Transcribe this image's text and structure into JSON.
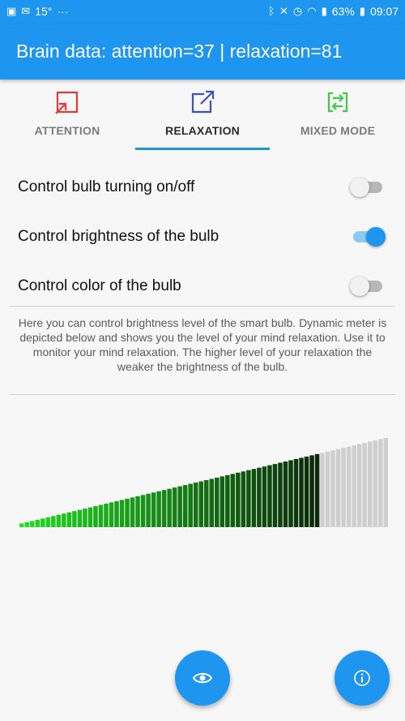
{
  "status_bar": {
    "temperature": "15°",
    "dots": "···",
    "battery": "63%",
    "time": "09:07"
  },
  "appbar": {
    "title": "Brain data: attention=37 | relaxation=81"
  },
  "tabs": [
    {
      "label": "ATTENTION",
      "icon": "enter-box-icon",
      "color": "#e53935",
      "active": false
    },
    {
      "label": "RELAXATION",
      "icon": "exit-box-icon",
      "color": "#3f51b5",
      "active": true
    },
    {
      "label": "MIXED MODE",
      "icon": "swap-box-icon",
      "color": "#43c84a",
      "active": false
    }
  ],
  "settings": [
    {
      "label": "Control bulb turning on/off",
      "on": false
    },
    {
      "label": "Control brightness of the bulb",
      "on": true
    },
    {
      "label": "Control color of the bulb",
      "on": false
    }
  ],
  "description": "Here you can control brightness level of the smart bulb. Dynamic meter is depicted below and shows you the level of your mind relaxation. Use it to monitor your mind relaxation. The higher level of your relaxation the weaker the brightness of the bulb.",
  "meter": {
    "level": 81,
    "max": 100,
    "bar_count": 70,
    "active_color_start": "#22dd22",
    "active_color_end": "#0a2a0a",
    "inactive_color": "#cfcfcf"
  },
  "fabs": [
    {
      "icon": "eye-icon"
    },
    {
      "icon": "info-icon"
    }
  ],
  "colors": {
    "primary": "#1e96f0",
    "indicator": "#2196c9"
  }
}
